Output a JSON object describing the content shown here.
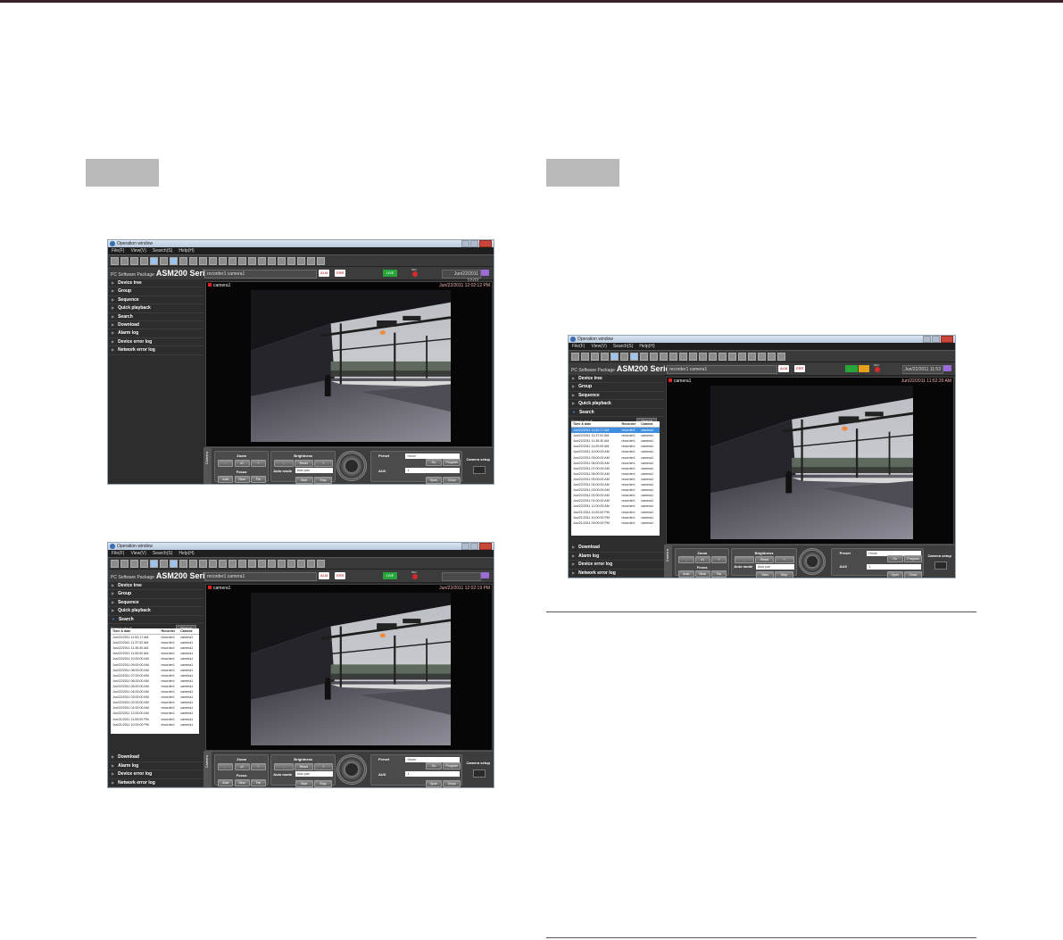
{
  "windows": [
    {
      "title": "Operation window",
      "menu": [
        "File(F)",
        "View(V)",
        "Search(S)",
        "Help(H)"
      ],
      "brand_small": "PC Software Package",
      "brand_large": "ASM200 Series",
      "camera_select": "recorder1 camera1",
      "btn_alarm": "ALM",
      "btn_error": "ERR",
      "live_badge": "LIVE",
      "rec_label": "REC",
      "datetime": "Jun/22/2011 12:02",
      "menu_top": [
        "Device tree",
        "Group",
        "Sequence",
        "Quick playback",
        "Search",
        "Download",
        "Alarm log",
        "Device error log",
        "Network error log"
      ],
      "menu_bottom": [],
      "search_result_label": "",
      "search_button": "",
      "results_header": [],
      "results": [],
      "video_camera": "camera1",
      "video_timestamp": "Jun/22/2011 12:02:12 PM",
      "controls": {
        "camera_tab": "Camera",
        "zoom": "Zoom",
        "zoom_btns": [
          "-",
          "x1",
          "+"
        ],
        "focus": "Focus",
        "focus_btns": [
          "Auto",
          "Near",
          "Far"
        ],
        "brightness": "Brightness",
        "brightness_btns": [
          "-",
          "Reset",
          "+"
        ],
        "auto_mode": "Auto mode",
        "auto_mode_value": "Auto pan",
        "start": "Start",
        "stop": "Stop",
        "preset": "Preset",
        "preset_value": "Home",
        "go": "Go",
        "program": "Program",
        "aux": "AUX",
        "aux_value": "1",
        "open": "Open",
        "close": "Close",
        "camera_setup": "Camera setup"
      }
    },
    {
      "title": "Operation window",
      "menu": [
        "File(F)",
        "View(V)",
        "Search(S)",
        "Help(H)"
      ],
      "brand_small": "PC Software Package",
      "brand_large": "ASM200 Series",
      "camera_select": "recorder1 camera1",
      "btn_alarm": "ALM",
      "btn_error": "ERR",
      "live_badge": "LIVE",
      "rec_label": "REC",
      "datetime": "",
      "menu_top": [
        "Device tree",
        "Group",
        "Sequence",
        "Quick playback",
        "Search"
      ],
      "menu_bottom": [
        "Download",
        "Alarm log",
        "Device error log",
        "Network error log"
      ],
      "search_result_label": "Search result",
      "search_button": "Search",
      "results_header": [
        "Time & date",
        "Recorder",
        "Camera"
      ],
      "results": [
        [
          "Jun/22/2011 11:52:17 AM",
          "recorder1",
          "camera1"
        ],
        [
          "Jun/22/2011 11:37:02 AM",
          "recorder1",
          "camera1"
        ],
        [
          "Jun/22/2011 11:35:30 AM",
          "recorder1",
          "camera1"
        ],
        [
          "Jun/22/2011 11:00:00 AM",
          "recorder1",
          "camera1"
        ],
        [
          "Jun/22/2011 10:00:00 AM",
          "recorder1",
          "camera1"
        ],
        [
          "Jun/22/2011 09:00:00 AM",
          "recorder1",
          "camera1"
        ],
        [
          "Jun/22/2011 08:00:00 AM",
          "recorder1",
          "camera1"
        ],
        [
          "Jun/22/2011 07:00:00 AM",
          "recorder1",
          "camera1"
        ],
        [
          "Jun/22/2011 06:00:00 AM",
          "recorder1",
          "camera1"
        ],
        [
          "Jun/22/2011 05:00:00 AM",
          "recorder1",
          "camera1"
        ],
        [
          "Jun/22/2011 04:00:00 AM",
          "recorder1",
          "camera1"
        ],
        [
          "Jun/22/2011 03:00:00 AM",
          "recorder1",
          "camera1"
        ],
        [
          "Jun/22/2011 02:00:00 AM",
          "recorder1",
          "camera1"
        ],
        [
          "Jun/22/2011 01:00:00 AM",
          "recorder1",
          "camera1"
        ],
        [
          "Jun/22/2011 12:00:00 AM",
          "recorder1",
          "camera1"
        ],
        [
          "Jun/21/2011 11:00:00 PM",
          "recorder1",
          "camera1"
        ],
        [
          "Jun/21/2011 10:00:00 PM",
          "recorder1",
          "camera1"
        ]
      ],
      "video_camera": "camera1",
      "video_timestamp": "Jun/22/2011 12:02:19 PM",
      "controls": {
        "camera_tab": "Camera",
        "zoom": "Zoom",
        "zoom_btns": [
          "-",
          "x1",
          "+"
        ],
        "focus": "Focus",
        "focus_btns": [
          "Auto",
          "Near",
          "Far"
        ],
        "brightness": "Brightness",
        "brightness_btns": [
          "-",
          "Reset",
          "+"
        ],
        "auto_mode": "Auto mode",
        "auto_mode_value": "Auto pan",
        "start": "Start",
        "stop": "Stop",
        "preset": "Preset",
        "preset_value": "Home",
        "go": "Go",
        "program": "Program",
        "aux": "AUX",
        "aux_value": "1",
        "open": "Open",
        "close": "Close",
        "camera_setup": "Camera setup"
      }
    },
    {
      "title": "Operation window",
      "menu": [
        "File(F)",
        "View(V)",
        "Search(S)",
        "Help(H)"
      ],
      "brand_small": "PC Software Package",
      "brand_large": "ASM200 Series",
      "camera_select": "recorder1 camera1",
      "btn_alarm": "ALM",
      "btn_error": "ERR",
      "live_badge": "",
      "rec_label": "REC",
      "datetime": "Jun/22/2011 11:53",
      "menu_top": [
        "Device tree",
        "Group",
        "Sequence",
        "Quick playback",
        "Search"
      ],
      "menu_bottom": [
        "Download",
        "Alarm log",
        "Device error log",
        "Network error log"
      ],
      "search_result_label": "Search result",
      "search_button": "Search",
      "results_header": [
        "Time & date",
        "Recorder",
        "Camera"
      ],
      "results": [
        [
          "Jun/22/2011 11:52:17 AM",
          "recorder1",
          "camera1"
        ],
        [
          "Jun/22/2011 11:37:02 AM",
          "recorder1",
          "camera1"
        ],
        [
          "Jun/22/2011 11:35:30 AM",
          "recorder1",
          "camera1"
        ],
        [
          "Jun/22/2011 11:00:00 AM",
          "recorder1",
          "camera1"
        ],
        [
          "Jun/22/2011 10:00:00 AM",
          "recorder1",
          "camera1"
        ],
        [
          "Jun/22/2011 09:00:00 AM",
          "recorder1",
          "camera1"
        ],
        [
          "Jun/22/2011 08:00:00 AM",
          "recorder1",
          "camera1"
        ],
        [
          "Jun/22/2011 07:00:00 AM",
          "recorder1",
          "camera1"
        ],
        [
          "Jun/22/2011 06:00:00 AM",
          "recorder1",
          "camera1"
        ],
        [
          "Jun/22/2011 05:00:00 AM",
          "recorder1",
          "camera1"
        ],
        [
          "Jun/22/2011 04:00:00 AM",
          "recorder1",
          "camera1"
        ],
        [
          "Jun/22/2011 03:00:00 AM",
          "recorder1",
          "camera1"
        ],
        [
          "Jun/22/2011 02:00:00 AM",
          "recorder1",
          "camera1"
        ],
        [
          "Jun/22/2011 01:00:00 AM",
          "recorder1",
          "camera1"
        ],
        [
          "Jun/22/2011 12:00:00 AM",
          "recorder1",
          "camera1"
        ],
        [
          "Jun/21/2011 11:00:00 PM",
          "recorder1",
          "camera1"
        ],
        [
          "Jun/21/2011 10:00:00 PM",
          "recorder1",
          "camera1"
        ],
        [
          "Jun/21/2011 09:00:00 PM",
          "recorder1",
          "camera1"
        ]
      ],
      "video_camera": "camera1",
      "video_timestamp": "Jun/22/2011 11:52:20 AM",
      "controls": {
        "camera_tab": "Camera",
        "zoom": "Zoom",
        "zoom_btns": [
          "-",
          "x1",
          "+"
        ],
        "focus": "Focus",
        "focus_btns": [
          "Auto",
          "Near",
          "Far"
        ],
        "brightness": "Brightness",
        "brightness_btns": [
          "-",
          "Reset",
          "+"
        ],
        "auto_mode": "Auto mode",
        "auto_mode_value": "Auto pan",
        "start": "Start",
        "stop": "Stop",
        "preset": "Preset",
        "preset_value": "Home",
        "go": "Go",
        "program": "Program",
        "aux": "AUX",
        "aux_value": "1",
        "open": "Open",
        "close": "Close",
        "camera_setup": "Camera setup"
      }
    }
  ]
}
